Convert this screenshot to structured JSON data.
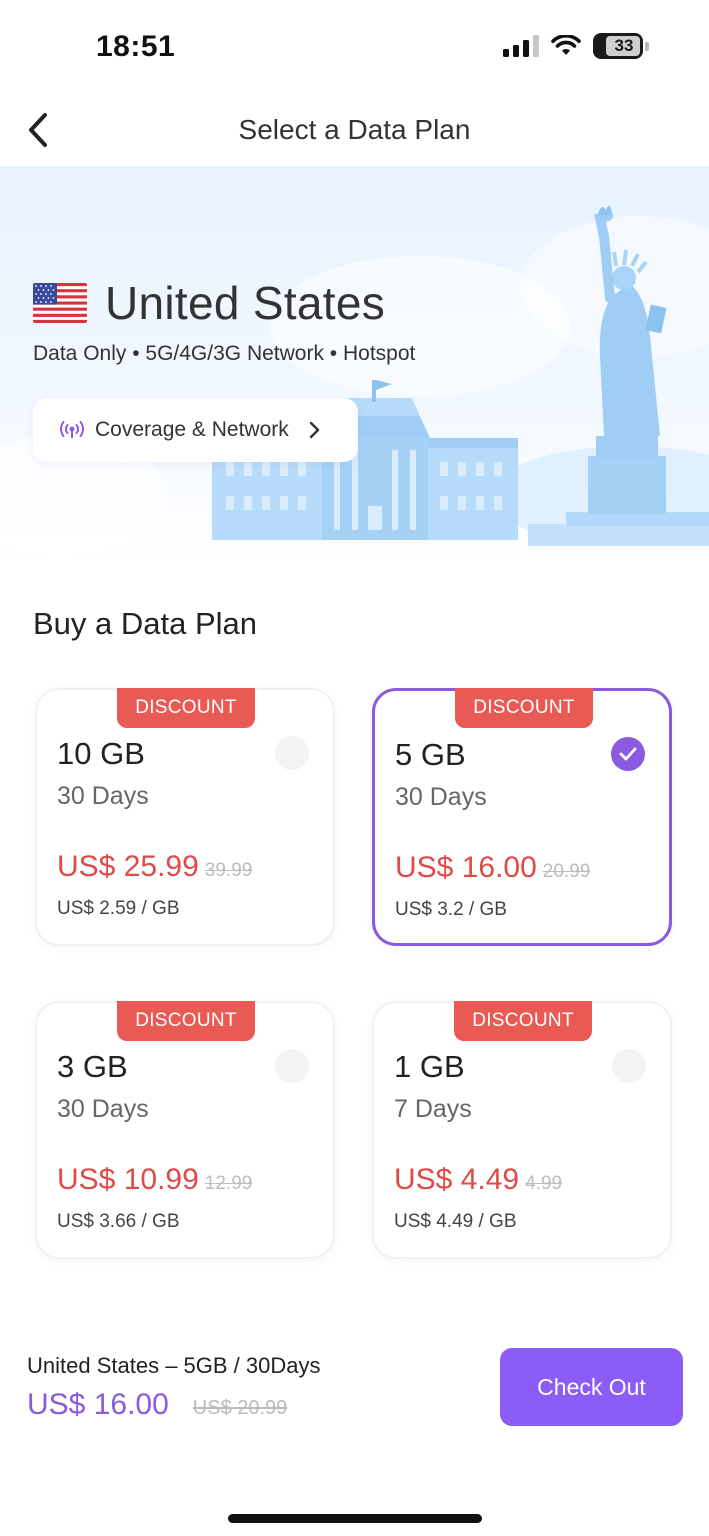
{
  "status_bar": {
    "time": "18:51",
    "battery": "33"
  },
  "nav": {
    "title": "Select a Data Plan"
  },
  "hero": {
    "country": "United States",
    "subtitle": "Data Only • 5G/4G/3G Network • Hotspot",
    "coverage_label": "Coverage & Network"
  },
  "section_title": "Buy a Data Plan",
  "plans": [
    {
      "tag": "DISCOUNT",
      "size": "10 GB",
      "days": "30 Days",
      "price": "US$ 25.99",
      "old_price": "39.99",
      "per_gb": "US$ 2.59 / GB",
      "selected": false
    },
    {
      "tag": "DISCOUNT",
      "size": "5 GB",
      "days": "30 Days",
      "price": "US$ 16.00",
      "old_price": "20.99",
      "per_gb": "US$ 3.2 / GB",
      "selected": true
    },
    {
      "tag": "DISCOUNT",
      "size": "3 GB",
      "days": "30 Days",
      "price": "US$ 10.99",
      "old_price": "12.99",
      "per_gb": "US$ 3.66 / GB",
      "selected": false
    },
    {
      "tag": "DISCOUNT",
      "size": "1 GB",
      "days": "7 Days",
      "price": "US$ 4.49",
      "old_price": "4.99",
      "per_gb": "US$ 4.49 / GB",
      "selected": false
    }
  ],
  "summary": {
    "title": "United States – 5GB / 30Days",
    "price": "US$ 16.00",
    "old_price": "US$ 20.99",
    "checkout_label": "Check Out"
  },
  "colors": {
    "accent": "#8b5cf6",
    "discount": "#e95a55",
    "price": "#e14a48"
  },
  "icons": [
    "back-icon",
    "signal-icon",
    "wifi-icon",
    "battery-icon",
    "us-flag-icon",
    "broadcast-icon",
    "chevron-right-icon",
    "check-icon"
  ]
}
